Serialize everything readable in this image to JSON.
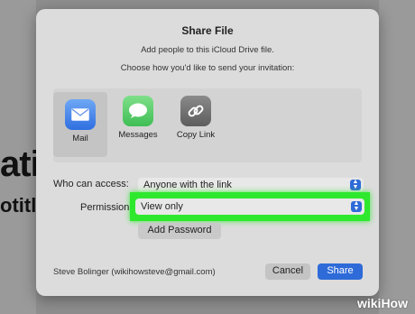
{
  "background": {
    "fragment_1": "ati",
    "fragment_2": "otitle"
  },
  "dialog": {
    "title": "Share File",
    "subtitle": "Add people to this iCloud Drive file.",
    "instruction": "Choose how you'd like to send your invitation:",
    "share_methods": [
      {
        "label": "Mail",
        "icon": "mail-icon",
        "selected": true
      },
      {
        "label": "Messages",
        "icon": "messages-icon",
        "selected": false
      },
      {
        "label": "Copy Link",
        "icon": "link-icon",
        "selected": false
      }
    ],
    "access": {
      "label": "Who can access:",
      "value": "Anyone with the link"
    },
    "permission": {
      "label": "Permission",
      "value": "View only"
    },
    "add_password_label": "Add Password",
    "user": "Steve Bolinger (wikihowsteve@gmail.com)",
    "cancel_label": "Cancel",
    "share_label": "Share"
  },
  "watermark": "wikiHow",
  "colors": {
    "accent": "#2e6bd8",
    "highlight": "#2ee82e"
  }
}
